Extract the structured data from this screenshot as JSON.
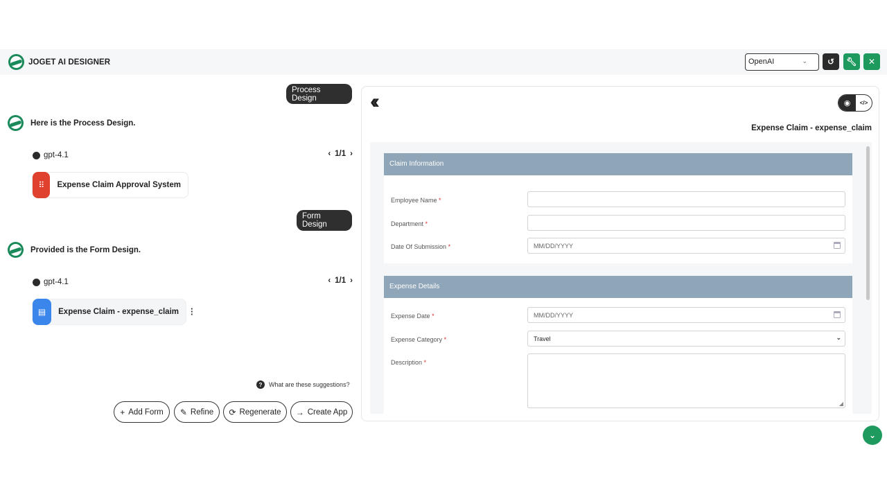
{
  "header": {
    "brand": "JOGET AI DESIGNER",
    "provider_selected": "OpenAI"
  },
  "chat": {
    "process_bubble": "Process Design",
    "process_response": "Here is the Process Design.",
    "process_model": "gpt-4.1",
    "process_pager": "1/1",
    "process_card": "Expense Claim Approval System",
    "form_bubble": "Form Design",
    "form_response": "Provided is the Form Design.",
    "form_model": "gpt-4.1",
    "form_pager": "1/1",
    "form_card": "Expense Claim - expense_claim",
    "suggestions_help": "What are these suggestions?",
    "actions": {
      "add_form": "Add Form",
      "refine": "Refine",
      "regenerate": "Regenerate",
      "create_app": "Create App"
    }
  },
  "preview": {
    "form_title": "Expense Claim - expense_claim",
    "sections": [
      {
        "title": "Claim Information",
        "fields": [
          {
            "label": "Employee Name",
            "value": ""
          },
          {
            "label": "Department",
            "value": ""
          },
          {
            "label": "Date Of Submission",
            "placeholder": "MM/DD/YYYY"
          }
        ]
      },
      {
        "title": "Expense Details",
        "fields": [
          {
            "label": "Expense Date",
            "placeholder": "MM/DD/YYYY"
          },
          {
            "label": "Expense Category",
            "value": "Travel"
          },
          {
            "label": "Description",
            "value": ""
          }
        ]
      }
    ]
  },
  "colors": {
    "brand_green": "#1e9a5e",
    "section_header": "#8fa5b8",
    "process_icon": "#e0412e",
    "form_icon": "#3b86ea"
  }
}
